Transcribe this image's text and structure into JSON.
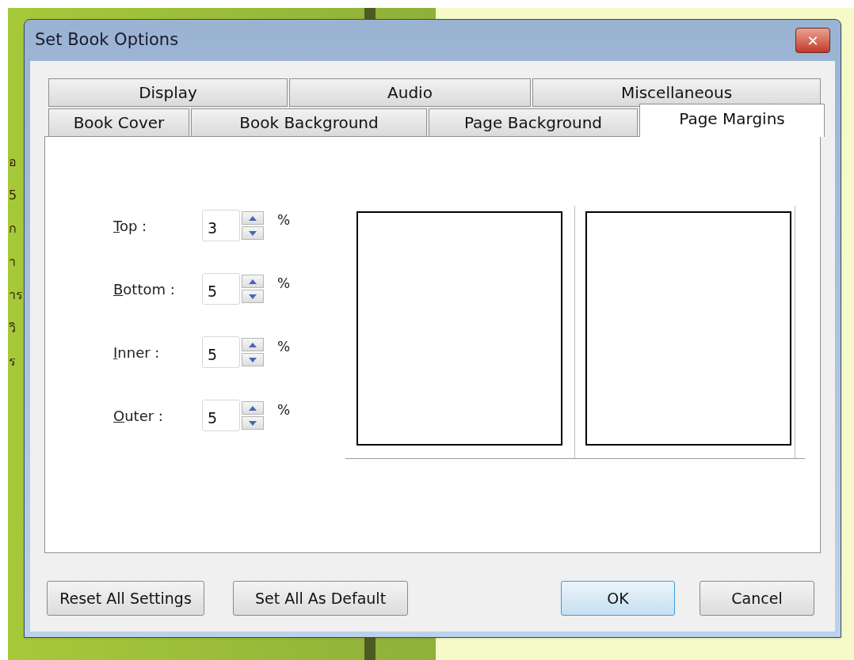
{
  "background": {
    "text_fragments": [
      "อ",
      "5",
      "ก",
      "า",
      "าร",
      "วิ",
      "ร"
    ]
  },
  "window": {
    "title": "Set Book Options",
    "close": "✕"
  },
  "tabs": [
    [
      {
        "label": "Display",
        "selected": false
      },
      {
        "label": "Audio",
        "selected": false
      },
      {
        "label": "Miscellaneous",
        "selected": false
      }
    ],
    [
      {
        "label": "Book Cover",
        "selected": false
      },
      {
        "label": "Book Background",
        "selected": false
      },
      {
        "label": "Page Background",
        "selected": false
      },
      {
        "label": "Page Margins",
        "selected": true
      }
    ]
  ],
  "margins": [
    {
      "label": "Top :",
      "value": "3",
      "unit": "%"
    },
    {
      "label": "Bottom :",
      "value": "5",
      "unit": "%"
    },
    {
      "label": "Inner :",
      "value": "5",
      "unit": "%"
    },
    {
      "label": "Outer :",
      "value": "5",
      "unit": "%"
    }
  ],
  "buttons": [
    {
      "label": "Reset All Settings",
      "kind": "normal"
    },
    {
      "label": "Set All As Default",
      "kind": "normal"
    },
    {
      "label": "OK",
      "kind": "default"
    },
    {
      "label": "Cancel",
      "kind": "normal"
    }
  ]
}
